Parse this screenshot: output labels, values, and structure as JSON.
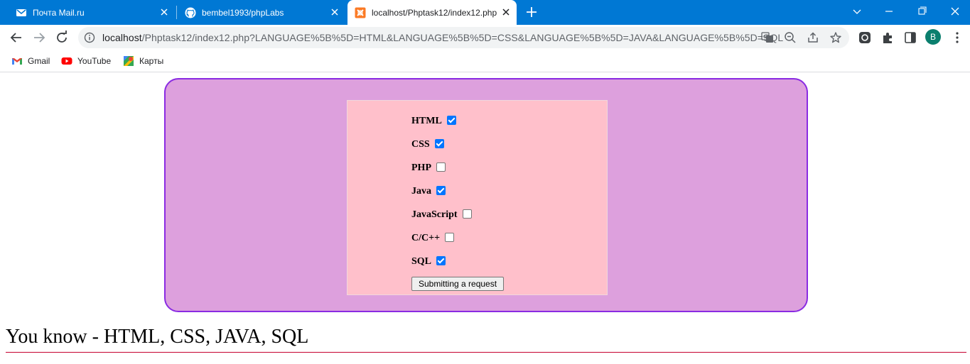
{
  "browser": {
    "tabs": [
      {
        "title": "Почта Mail.ru",
        "active": false
      },
      {
        "title": "bembel1993/phpLabs",
        "active": false
      },
      {
        "title": "localhost/Phptask12/index12.php",
        "active": true
      }
    ],
    "url_host": "localhost",
    "url_rest": "/Phptask12/index12.php?LANGUAGE%5B%5D=HTML&LANGUAGE%5B%5D=CSS&LANGUAGE%5B%5D=JAVA&LANGUAGE%5B%5D=SQL",
    "profile_initial": "B",
    "bookmarks": [
      "Gmail",
      "YouTube",
      "Карты"
    ],
    "accent_color": "#0078d4"
  },
  "form": {
    "options": [
      {
        "label": "HTML",
        "checked": true
      },
      {
        "label": "CSS",
        "checked": true
      },
      {
        "label": "PHP",
        "checked": false
      },
      {
        "label": "Java",
        "checked": true
      },
      {
        "label": "JavaScript",
        "checked": false
      },
      {
        "label": "C/C++",
        "checked": false
      },
      {
        "label": "SQL",
        "checked": true
      }
    ],
    "submit_label": "Submitting a request"
  },
  "result_text": "You know - HTML, CSS, JAVA, SQL",
  "colors": {
    "outer_background": "#dda0dd",
    "outer_border": "#8a2be2",
    "form_background": "#ffc0cb",
    "rule": "#c5002f",
    "checkbox_checked": "#0075ff"
  },
  "icons": {
    "tab_icons": [
      "mail-icon",
      "github-icon",
      "xampp-icon"
    ],
    "toolbar_icons": [
      "back-arrow-icon",
      "forward-arrow-icon",
      "reload-icon",
      "info-icon",
      "translate-icon",
      "zoom-out-icon",
      "share-icon",
      "star-icon",
      "extension-icon",
      "puzzle-icon",
      "side-panel-icon"
    ],
    "window_controls": [
      "chevron-down-icon",
      "minimize-icon",
      "restore-icon",
      "close-icon"
    ]
  }
}
